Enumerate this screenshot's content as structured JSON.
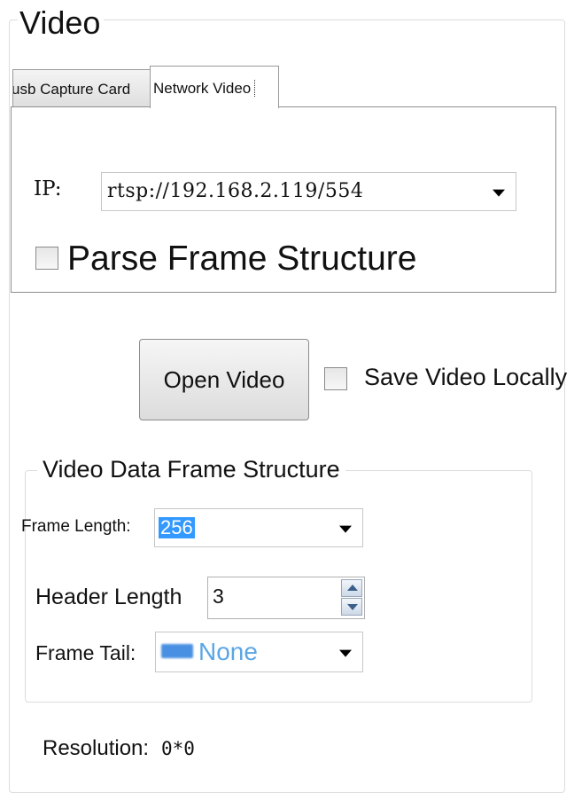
{
  "group": {
    "title": "Video"
  },
  "tabs": [
    {
      "label": "usb Capture Card",
      "selected": false
    },
    {
      "label": "Network Video",
      "selected": true
    }
  ],
  "network": {
    "ip_label": "IP:",
    "ip_value": "rtsp://192.168.2.119/554",
    "parse_label": "Parse Frame Structure",
    "parse_checked": false
  },
  "actions": {
    "open_label": "Open Video",
    "save_label": "Save Video Locally",
    "save_checked": false
  },
  "frame_structure": {
    "title": "Video Data Frame Structure",
    "frame_length_label": "Frame Length:",
    "frame_length_value": "256",
    "header_length_label": "Header Length",
    "header_length_value": "3",
    "frame_tail_label": "Frame Tail:",
    "frame_tail_value": "None"
  },
  "resolution": {
    "label": "Resolution:",
    "value": "0*0"
  },
  "colors": {
    "selection": "#3399ff",
    "tail_text": "#5aa6e6"
  },
  "icons": [
    "dropdown-arrow-icon",
    "spin-up-icon",
    "spin-down-icon"
  ]
}
